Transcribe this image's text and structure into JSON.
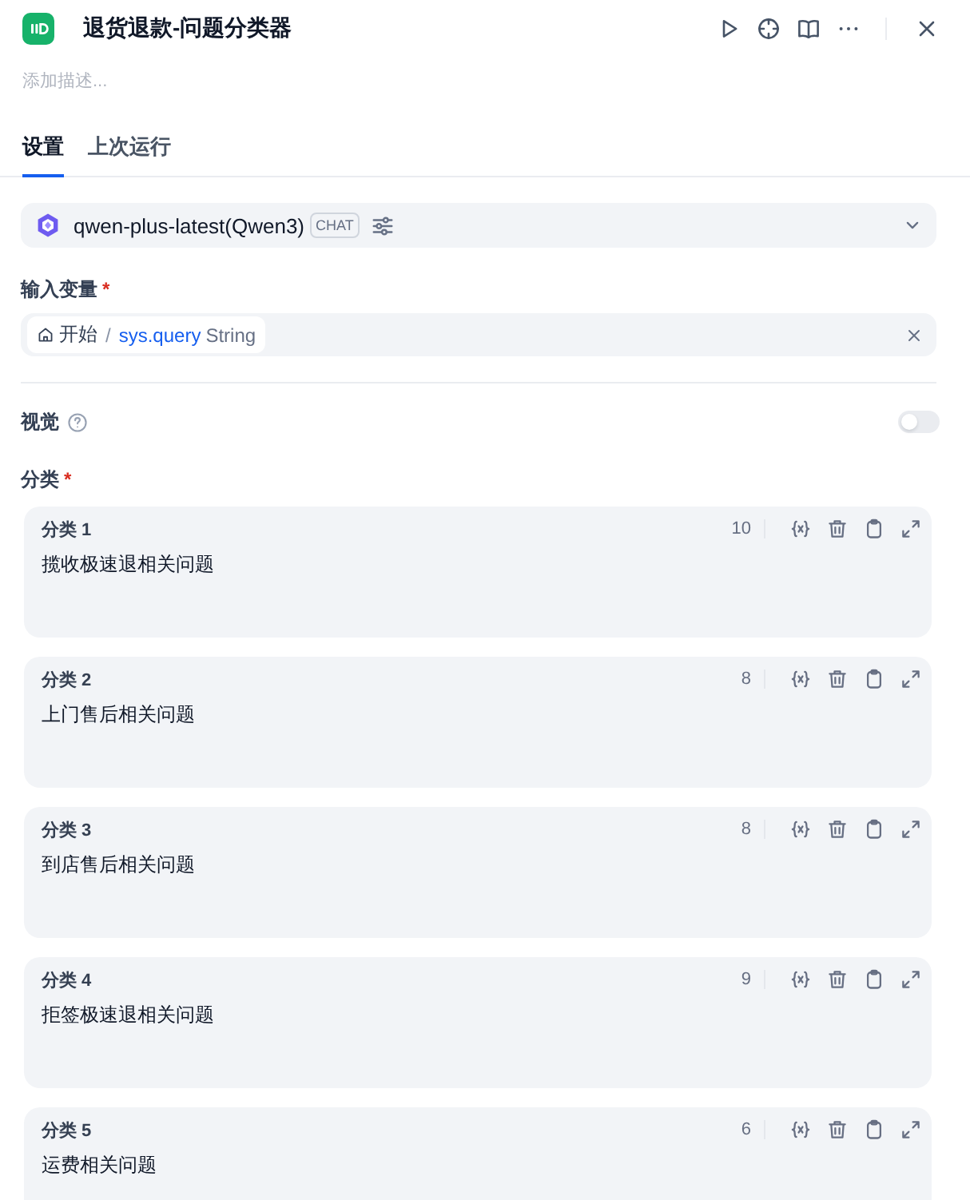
{
  "header": {
    "title": "退货退款-问题分类器",
    "description": {
      "placeholder": "添加描述..."
    }
  },
  "tabs": [
    {
      "label": "设置",
      "selected": true
    },
    {
      "label": "上次运行",
      "selected": false
    }
  ],
  "model": {
    "name": "qwen-plus-latest(Qwen3)",
    "badge": "CHAT"
  },
  "input_variable": {
    "label": "输入变量",
    "required_mark": "*",
    "node": "开始",
    "separator": "/",
    "variable": "sys.query",
    "type": "String"
  },
  "vision": {
    "label": "视觉",
    "on": false
  },
  "classes": {
    "label": "分类",
    "required_mark": "*",
    "items": [
      {
        "title": "分类 1",
        "count": "10",
        "text": "揽收极速退相关问题"
      },
      {
        "title": "分类 2",
        "count": "8",
        "text": "上门售后相关问题"
      },
      {
        "title": "分类 3",
        "count": "8",
        "text": "到店售后相关问题"
      },
      {
        "title": "分类 4",
        "count": "9",
        "text": "拒签极速退相关问题"
      },
      {
        "title": "分类 5",
        "count": "6",
        "text": "运费相关问题"
      }
    ]
  }
}
